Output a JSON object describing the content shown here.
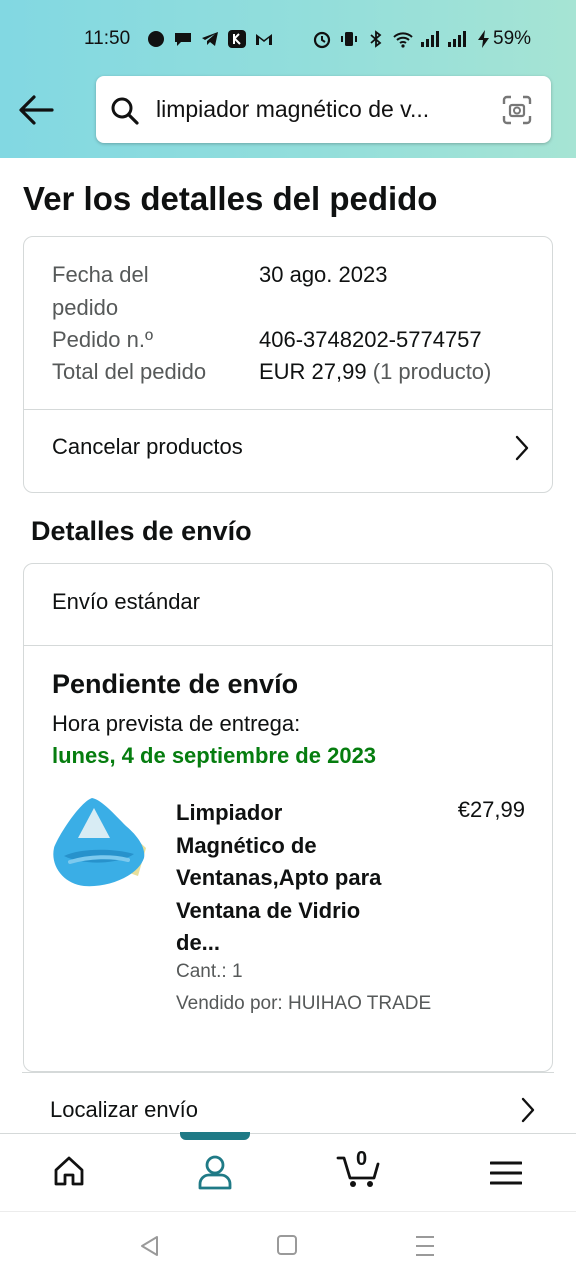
{
  "status_bar": {
    "time": "11:50",
    "battery": "59%"
  },
  "search": {
    "query": "limpiador magnético de v..."
  },
  "page_title": "Ver los detalles del pedido",
  "order": {
    "date_label_line1": "Fecha del",
    "date_label_line2": "pedido",
    "date_value": "30 ago. 2023",
    "number_label": "Pedido n.º",
    "number_value": "406-3748202-5774757",
    "total_label": "Total del pedido",
    "total_value": "EUR 27,99",
    "total_count": "(1 producto)",
    "cancel_label": "Cancelar productos"
  },
  "shipping": {
    "section_title": "Detalles de envío",
    "method": "Envío estándar",
    "status": "Pendiente de envío",
    "eta_label": "Hora prevista de entrega:",
    "eta_date": "lunes, 4 de septiembre de 2023",
    "product": {
      "title_lines": [
        "Limpiador",
        "Magnético de",
        "Ventanas,Apto para",
        "Ventana de Vidrio",
        "de..."
      ],
      "price": "€27,99",
      "qty": "Cant.: 1",
      "seller": "Vendido por: HUIHAO TRADE"
    },
    "track_label": "Localizar envío"
  },
  "bottom_nav": {
    "cart_count": "0",
    "active": "profile"
  },
  "colors": {
    "accent_green": "#067d0f",
    "nav_indicator": "#1f7a86",
    "profile_icon": "#1f7a86"
  }
}
